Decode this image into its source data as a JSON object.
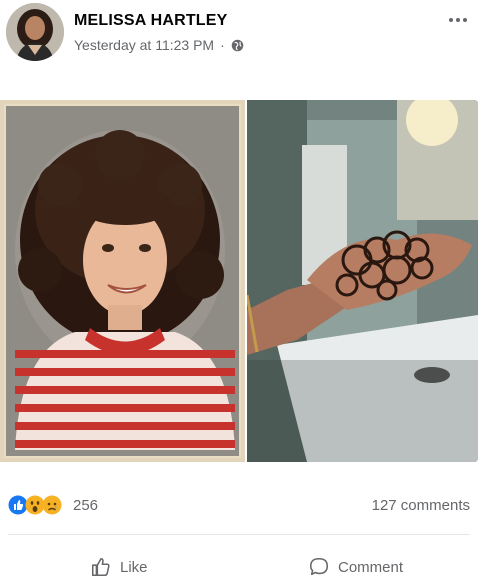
{
  "post": {
    "author": "MELISSA HARTLEY",
    "timestamp": "Yesterday at 11:23 PM",
    "separator": "·",
    "audience_icon": "globe-icon",
    "more_icon": "more-icon"
  },
  "reactions": {
    "icons": [
      "like-icon",
      "wow-icon",
      "sad-icon"
    ],
    "count": "256",
    "comments": "127 comments"
  },
  "actions": {
    "like_label": "Like",
    "comment_label": "Comment"
  },
  "colors": {
    "like_blue": "#1877f2",
    "reaction_yellow": "#f7b125",
    "meta_gray": "#65676b",
    "sweater_red": "#c8322c"
  }
}
